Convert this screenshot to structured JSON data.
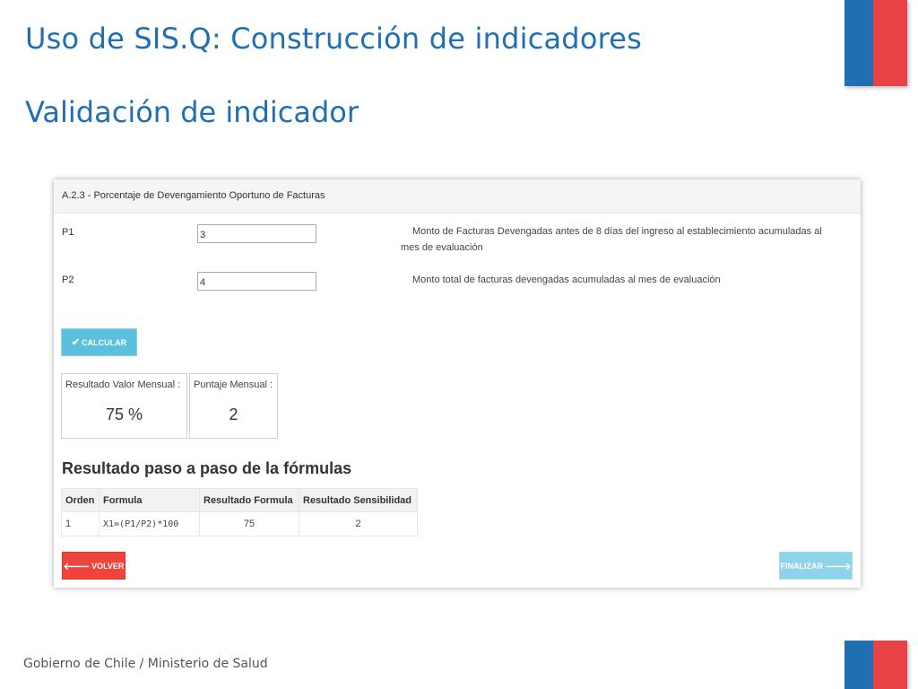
{
  "slide": {
    "title": "Uso de SIS.Q: Construcción de indicadores",
    "subtitle": "Validación de indicador",
    "footer": "Gobierno de Chile / Ministerio de Salud"
  },
  "panel": {
    "header": "A.2.3 - Porcentaje de Devengamiento Oportuno de Facturas",
    "fields": [
      {
        "label": "P1",
        "value": "3",
        "description": "Monto de Facturas Devengadas antes de 8 días del ingreso al establecimiento acumuladas al",
        "description_cont": "mes de evaluación"
      },
      {
        "label": "P2",
        "value": "4",
        "description": "Monto total de facturas devengadas acumuladas al mes de evaluación"
      }
    ],
    "calc_button": "CALCULAR",
    "results": [
      {
        "label": "Resultado Valor Mensual :",
        "value": "75 %"
      },
      {
        "label": "Puntaje Mensual :",
        "value": "2"
      }
    ],
    "steps_title": "Resultado paso a paso de la fórmulas",
    "table": {
      "headers": [
        "Orden",
        "Formula",
        "Resultado Formula",
        "Resultado Sensibilidad"
      ],
      "rows": [
        [
          "1",
          "X1=(P1/P2)*100",
          "75",
          "2"
        ]
      ]
    },
    "back_button": "VOLVER",
    "finish_button": "FINALIZAR"
  },
  "icons": {
    "calc": "check-icon",
    "back": "arrow-left-icon",
    "finish": "arrow-right-icon"
  },
  "colors": {
    "title": "#1f6fb2",
    "flag_blue": "#1f6fb2",
    "flag_red": "#e84447",
    "btn_calc": "#5bc0de",
    "btn_back": "#f0433a",
    "btn_finish": "#8fd3ea"
  }
}
